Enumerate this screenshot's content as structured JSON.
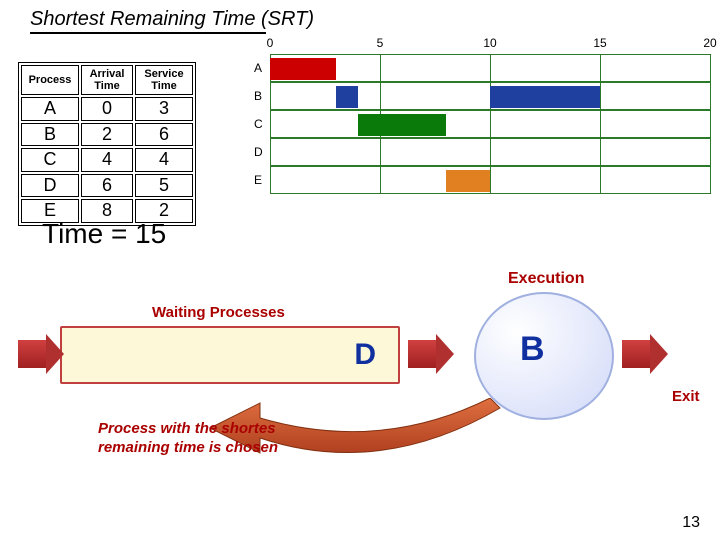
{
  "title": "Shortest Remaining Time (SRT)",
  "table": {
    "headers": [
      "Process",
      "Arrival Time",
      "Service Time"
    ],
    "rows": [
      {
        "p": "A",
        "a": "0",
        "s": "3"
      },
      {
        "p": "B",
        "a": "2",
        "s": "6"
      },
      {
        "p": "C",
        "a": "4",
        "s": "4"
      },
      {
        "p": "D",
        "a": "6",
        "s": "5"
      },
      {
        "p": "E",
        "a": "8",
        "s": "2"
      }
    ]
  },
  "chart_data": {
    "type": "bar",
    "title": "",
    "xlabel": "",
    "ylabel": "",
    "xlim": [
      0,
      20
    ],
    "ticks": [
      0,
      5,
      10,
      15,
      20
    ],
    "categories": [
      "A",
      "B",
      "C",
      "D",
      "E"
    ],
    "series": [
      {
        "name": "A",
        "color": "#cc0000",
        "segments": [
          {
            "start": 0,
            "end": 3
          }
        ]
      },
      {
        "name": "B",
        "color": "#2040a0",
        "segments": [
          {
            "start": 3,
            "end": 4
          },
          {
            "start": 10,
            "end": 15
          }
        ]
      },
      {
        "name": "C",
        "color": "#0a7a0a",
        "segments": [
          {
            "start": 4,
            "end": 8
          }
        ]
      },
      {
        "name": "D",
        "color": "",
        "segments": []
      },
      {
        "name": "E",
        "color": "#e08020",
        "segments": [
          {
            "start": 8,
            "end": 10
          }
        ]
      }
    ]
  },
  "time_label": "Time = 15",
  "execution_label": "Execution",
  "waiting_label": "Waiting Processes",
  "waiting_procs": [
    "D"
  ],
  "running_proc": "B",
  "exit_label": "Exit",
  "caption_line1": "Process with the shortes",
  "caption_line2": "remaining time is chosen",
  "page_num": "13"
}
